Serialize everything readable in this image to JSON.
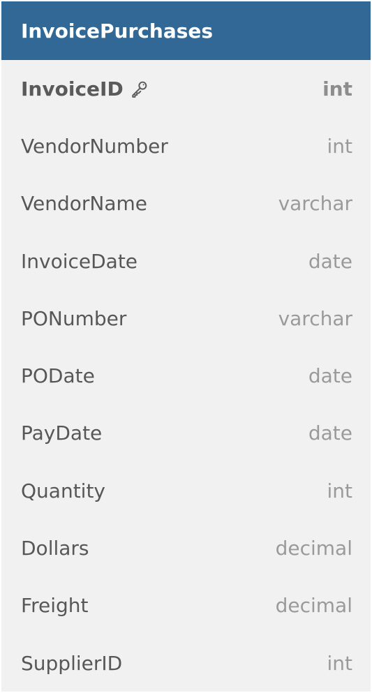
{
  "table": {
    "name": "InvoicePurchases",
    "columns": [
      {
        "name": "InvoiceID",
        "type": "int",
        "primary_key": true
      },
      {
        "name": "VendorNumber",
        "type": "int"
      },
      {
        "name": "VendorName",
        "type": "varchar"
      },
      {
        "name": "InvoiceDate",
        "type": "date"
      },
      {
        "name": "PONumber",
        "type": "varchar"
      },
      {
        "name": "PODate",
        "type": "date"
      },
      {
        "name": "PayDate",
        "type": "date"
      },
      {
        "name": "Quantity",
        "type": "int"
      },
      {
        "name": "Dollars",
        "type": "decimal"
      },
      {
        "name": "Freight",
        "type": "decimal"
      },
      {
        "name": "SupplierID",
        "type": "int"
      }
    ]
  },
  "colors": {
    "header_bg": "#316896",
    "header_text": "#ffffff",
    "body_bg": "#f1f1f1",
    "name_text": "#575757",
    "type_text": "#9a9a9a"
  },
  "icons": {
    "primary_key": "key-icon"
  }
}
